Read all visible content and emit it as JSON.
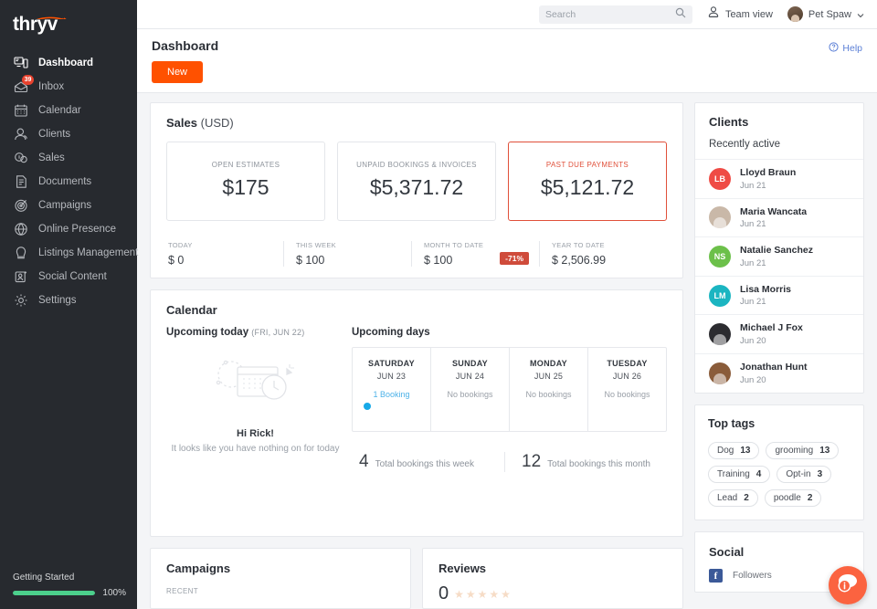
{
  "brand": {
    "logo_text": "thryv",
    "accent": "#ff5100"
  },
  "sidebar": {
    "items": [
      {
        "label": "Dashboard",
        "icon": "dashboard-icon",
        "active": true
      },
      {
        "label": "Inbox",
        "icon": "inbox-icon",
        "badge": "39"
      },
      {
        "label": "Calendar",
        "icon": "calendar-icon"
      },
      {
        "label": "Clients",
        "icon": "clients-icon"
      },
      {
        "label": "Sales",
        "icon": "sales-icon"
      },
      {
        "label": "Documents",
        "icon": "documents-icon"
      },
      {
        "label": "Campaigns",
        "icon": "campaigns-icon"
      },
      {
        "label": "Online Presence",
        "icon": "globe-icon"
      },
      {
        "label": "Listings Management",
        "icon": "listings-icon"
      },
      {
        "label": "Social Content",
        "icon": "social-content-icon"
      },
      {
        "label": "Settings",
        "icon": "gear-icon"
      }
    ],
    "getting_started": {
      "label": "Getting Started",
      "percent": "100%",
      "progress": 100,
      "color": "#4cd08c"
    }
  },
  "topbar": {
    "search": {
      "placeholder": "Search",
      "value": ""
    },
    "team_view": "Team view",
    "account": "Pet Spaw"
  },
  "pagehead": {
    "title": "Dashboard",
    "new_button": "New",
    "help": "Help"
  },
  "sales": {
    "title_bold": "Sales",
    "title_light": "(USD)",
    "stats": [
      {
        "label": "OPEN ESTIMATES",
        "value": "$175",
        "danger": false
      },
      {
        "label": "UNPAID BOOKINGS & INVOICES",
        "value": "$5,371.72",
        "danger": false
      },
      {
        "label": "PAST DUE PAYMENTS",
        "value": "$5,121.72",
        "danger": true
      }
    ],
    "minis": [
      {
        "label": "TODAY",
        "value": "$ 0",
        "pill": ""
      },
      {
        "label": "THIS WEEK",
        "value": "$ 100",
        "pill": ""
      },
      {
        "label": "MONTH TO DATE",
        "value": "$ 100",
        "pill": "-71%"
      },
      {
        "label": "YEAR TO DATE",
        "value": "$ 2,506.99",
        "pill": ""
      }
    ]
  },
  "calendar": {
    "title": "Calendar",
    "upcoming_today_label": "Upcoming today",
    "upcoming_today_date": "(FRI, JUN 22)",
    "empty_greeting": "Hi Rick!",
    "empty_text": "It looks like you have nothing on for today",
    "upcoming_days_label": "Upcoming days",
    "days": [
      {
        "name": "SATURDAY",
        "date": "JUN 23",
        "info": "1 Booking",
        "has_booking": true
      },
      {
        "name": "SUNDAY",
        "date": "JUN 24",
        "info": "No bookings",
        "has_booking": false
      },
      {
        "name": "MONDAY",
        "date": "JUN 25",
        "info": "No bookings",
        "has_booking": false
      },
      {
        "name": "TUESDAY",
        "date": "JUN 26",
        "info": "No bookings",
        "has_booking": false
      }
    ],
    "totals": [
      {
        "num": "4",
        "text": "Total bookings this week"
      },
      {
        "num": "12",
        "text": "Total bookings this month"
      }
    ]
  },
  "clients": {
    "title": "Clients",
    "subtitle": "Recently active",
    "list": [
      {
        "name": "Lloyd Braun",
        "date": "Jun 21",
        "initials": "LB",
        "color": "#ef4b45",
        "photo": false
      },
      {
        "name": "Maria Wancata",
        "date": "Jun 21",
        "initials": "",
        "color": "#c9b8a8",
        "photo": true
      },
      {
        "name": "Natalie Sanchez",
        "date": "Jun 21",
        "initials": "NS",
        "color": "#6cc04a",
        "photo": false
      },
      {
        "name": "Lisa Morris",
        "date": "Jun 21",
        "initials": "LM",
        "color": "#1bb5c1",
        "photo": false
      },
      {
        "name": "Michael J Fox",
        "date": "Jun 20",
        "initials": "",
        "color": "#2c2c30",
        "photo": true
      },
      {
        "name": "Jonathan Hunt",
        "date": "Jun 20",
        "initials": "",
        "color": "#8a5c3a",
        "photo": true
      }
    ]
  },
  "top_tags": {
    "title": "Top tags",
    "tags": [
      {
        "name": "Dog",
        "count": "13"
      },
      {
        "name": "grooming",
        "count": "13"
      },
      {
        "name": "Training",
        "count": "4"
      },
      {
        "name": "Opt-in",
        "count": "3"
      },
      {
        "name": "Lead",
        "count": "2"
      },
      {
        "name": "poodle",
        "count": "2"
      }
    ]
  },
  "campaigns": {
    "title": "Campaigns",
    "subtitle": "RECENT"
  },
  "reviews": {
    "title": "Reviews",
    "rating": "0",
    "stars": "★★★★★"
  },
  "social": {
    "title": "Social",
    "followers_label": "Followers",
    "network": "facebook"
  }
}
